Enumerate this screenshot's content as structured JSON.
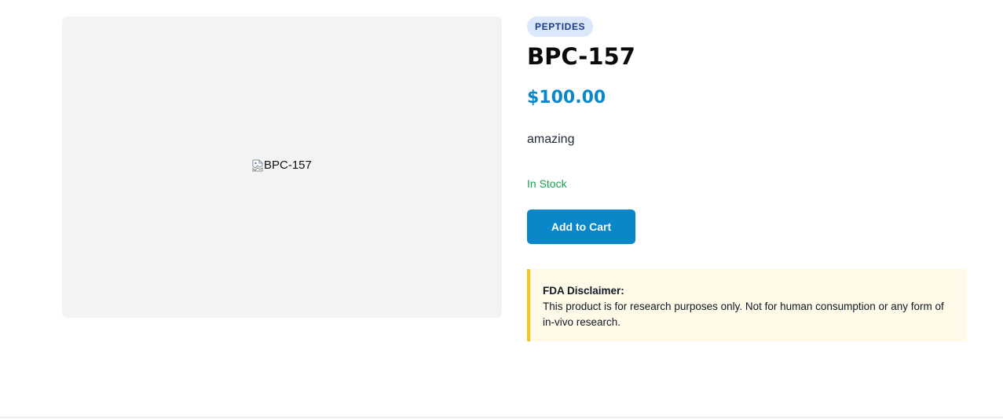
{
  "product": {
    "image_alt": "BPC-157",
    "category_badge": "PEPTIDES",
    "name": "BPC-157",
    "price": "$100.00",
    "description": "amazing",
    "stock_status": "In Stock",
    "add_to_cart_label": "Add to Cart"
  },
  "disclaimer": {
    "title": "FDA Disclaimer:",
    "text": "This product is for research purposes only. Not for human consumption or any form of in-vivo research."
  },
  "colors": {
    "accent": "#0a87c8",
    "in_stock": "#16a34a",
    "badge_bg": "#dbe7fb",
    "disclaimer_border": "#f5c518",
    "disclaimer_bg": "#fefae7"
  },
  "icons": {
    "broken_image": "broken-image-icon"
  }
}
